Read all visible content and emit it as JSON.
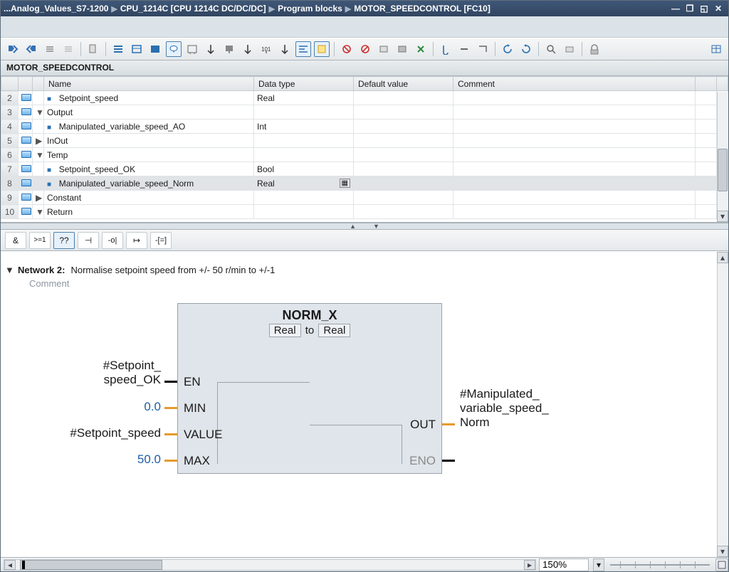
{
  "title": {
    "p1": "...Analog_Values_S7-1200",
    "p2": "CPU_1214C [CPU 1214C DC/DC/DC]",
    "p3": "Program blocks",
    "p4": "MOTOR_SPEEDCONTROL [FC10]"
  },
  "block_name": "MOTOR_SPEEDCONTROL",
  "columns": {
    "name": "Name",
    "dtype": "Data type",
    "def": "Default value",
    "comment": "Comment"
  },
  "rows": [
    {
      "n": "2",
      "kind": "var",
      "indent": 2,
      "name": "Setpoint_speed",
      "dtype": "Real"
    },
    {
      "n": "3",
      "kind": "section",
      "caret": "▾",
      "name": "Output"
    },
    {
      "n": "4",
      "kind": "var",
      "indent": 2,
      "name": "Manipulated_variable_speed_AO",
      "dtype": "Int"
    },
    {
      "n": "5",
      "kind": "section",
      "caret": "▸",
      "name": "InOut"
    },
    {
      "n": "6",
      "kind": "section",
      "caret": "▾",
      "name": "Temp"
    },
    {
      "n": "7",
      "kind": "var",
      "indent": 2,
      "name": "Setpoint_speed_OK",
      "dtype": "Bool"
    },
    {
      "n": "8",
      "kind": "var",
      "indent": 2,
      "name": "Manipulated_variable_speed_Norm",
      "dtype": "Real",
      "sel": true
    },
    {
      "n": "9",
      "kind": "section",
      "caret": "▸",
      "name": "Constant"
    },
    {
      "n": "10",
      "kind": "section",
      "caret": "▾",
      "name": "Return"
    }
  ],
  "fbd_ops": {
    "and": "&",
    "ge": ">=1",
    "q": "??",
    "neg": "⊣",
    "assign": "-o|",
    "jmp": "↦",
    "ret": "-[=]"
  },
  "network": {
    "label": "Network 2:",
    "title": "Normalise setpoint speed from +/- 50 r/min to  +/-1",
    "comment": "Comment"
  },
  "box": {
    "title": "NORM_X",
    "t1": "Real",
    "to": "to",
    "t2": "Real",
    "pins_left": [
      "EN",
      "MIN",
      "VALUE",
      "MAX"
    ],
    "pins_right": [
      "OUT",
      "ENO"
    ]
  },
  "tags": {
    "en_a": "#Setpoint_",
    "en_b": "speed_OK",
    "min": "0.0",
    "value": "#Setpoint_speed",
    "max": "50.0",
    "out_a": "#Manipulated_",
    "out_b": "variable_speed_",
    "out_c": "Norm"
  },
  "zoom": "150%"
}
